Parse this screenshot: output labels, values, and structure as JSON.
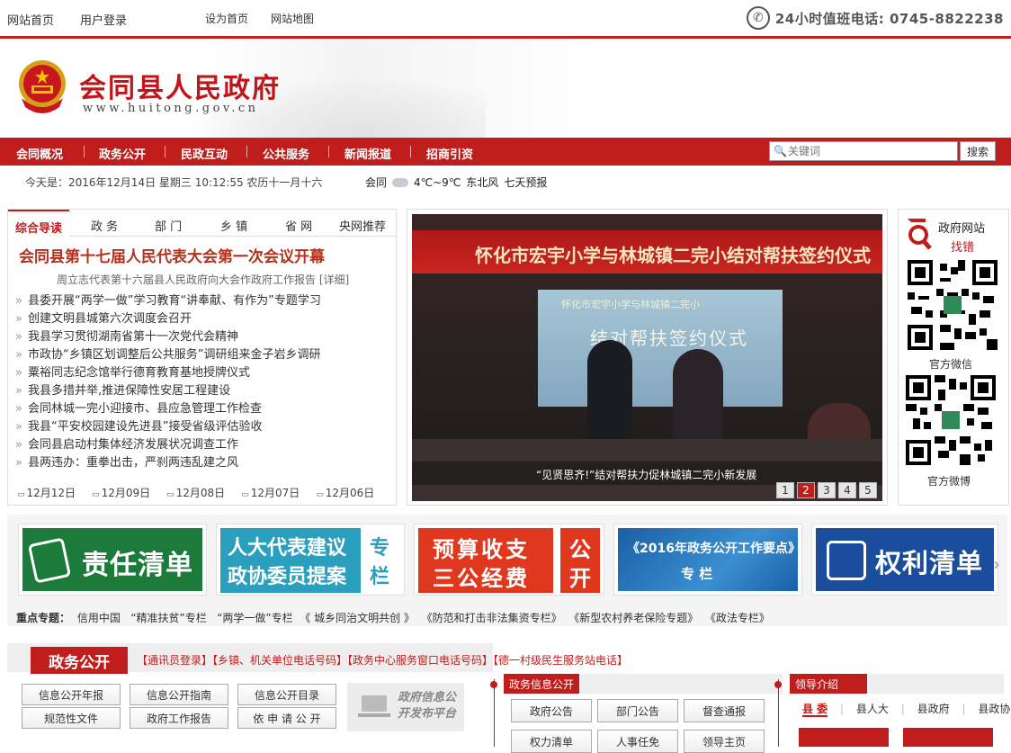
{
  "topbar": {
    "links": [
      "网站首页",
      "用户登录",
      "设为首页",
      "网站地图"
    ],
    "hotline": "24小时值班电话: 0745-8822238"
  },
  "header": {
    "title": "会同县人民政府",
    "url": "www.huitong.gov.cn"
  },
  "nav": {
    "items": [
      "会同概况",
      "政务公开",
      "民政互动",
      "公共服务",
      "新闻报道",
      "招商引资"
    ],
    "search_placeholder": "关键词",
    "search_button": "搜索"
  },
  "infobar": {
    "date": "今天是：2016年12月14日 星期三 10:12:55 农历十一月十六",
    "city": "会同",
    "temp": "4℃~9℃",
    "wind": "东北风",
    "forecast": "七天预报"
  },
  "news": {
    "tabs": [
      "综合导读",
      "政 务",
      "部 门",
      "乡 镇",
      "省 网",
      "央网推荐"
    ],
    "headline": "会同县第十七届人民代表大会第一次会议开幕",
    "subline": "周立志代表第十六届县人民政府向大会作政府工作报告 [详细]",
    "items": [
      "县委开展“两学一做”学习教育“讲奉献、有作为”专题学习",
      "创建文明县城第六次调度会召开",
      "我县学习贯彻湖南省第十一次党代会精神",
      "市政协“乡镇区划调整后公共服务”调研组来金子岩乡调研",
      "粟裕同志纪念馆举行德育教育基地授牌仪式",
      "我县多措并举,推进保障性安居工程建设",
      "会同林城一完小迎接市、县应急管理工作检查",
      "我县“平安校园建设先进县”接受省级评估验收",
      "会同县启动村集体经济发展状况调查工作",
      "县两违办：重拳出击，严刹两违乱建之风"
    ],
    "dates": [
      "12月12日",
      "12月09日",
      "12月08日",
      "12月07日",
      "12月06日"
    ]
  },
  "slide": {
    "banner": "怀化市宏宇小学与林城镇二完小结对帮扶签约仪式",
    "screen_line1": "怀化市宏宇小学与林城镇二完小",
    "screen_line2": "结对帮扶签约仪式",
    "caption": "“见贤思齐!”结对帮扶力促林城镇二完小新发展",
    "pages": [
      "1",
      "2",
      "3",
      "4",
      "5"
    ],
    "active_page": "2"
  },
  "qr": {
    "title1": "政府网站",
    "title2": "找错",
    "label1": "官方微信",
    "label2": "官方微博"
  },
  "banners": {
    "b1": "责任清单",
    "b2_line1": "人大代表建议",
    "b2_line2": "政协委员提案",
    "b2_side1": "专",
    "b2_side2": "栏",
    "b3_line1": "预算收支",
    "b3_line2": "三公经费",
    "b3_side1": "公",
    "b3_side2": "开",
    "b4_line1": "《2016年政务公开工作要点》",
    "b4_line2": "专  栏",
    "b5": "权利清单",
    "colors": {
      "green": "#1c7a3a",
      "teal": "#2a9fbe",
      "orange": "#e0381e",
      "blue": "#1b5fa8",
      "navy": "#1a4e9c"
    }
  },
  "topics": {
    "label": "重点专题：",
    "items": [
      "信用中国",
      "“精准扶贫”专栏",
      "“两学一做”专栏",
      "《 城乡同治文明共创 》",
      "《防范和打击非法集资专栏》",
      "《新型农村养老保险专题》",
      "《政法专栏》"
    ]
  },
  "bottom": {
    "zw_title": "政务公开",
    "zw_links": "【通讯员登录】【乡镇、机关单位电话号码】【政务中心服务窗口电话号码】【德一村级民生服务站电话】",
    "buttons": [
      "信息公开年报",
      "信息公开指南",
      "信息公开目录",
      "规范性文件",
      "政府工作报告",
      "依 申 请 公 开"
    ],
    "platform": [
      "政府信息公",
      "开发布平台"
    ],
    "info_head": "政务信息公开",
    "info_buttons": [
      "政府公告",
      "部门公告",
      "督查通报",
      "权力清单",
      "人事任免",
      "领导主页"
    ],
    "leader_head": "领导介绍",
    "leader_tabs": [
      "县 委",
      "县人大",
      "县政府",
      "县政协"
    ]
  }
}
